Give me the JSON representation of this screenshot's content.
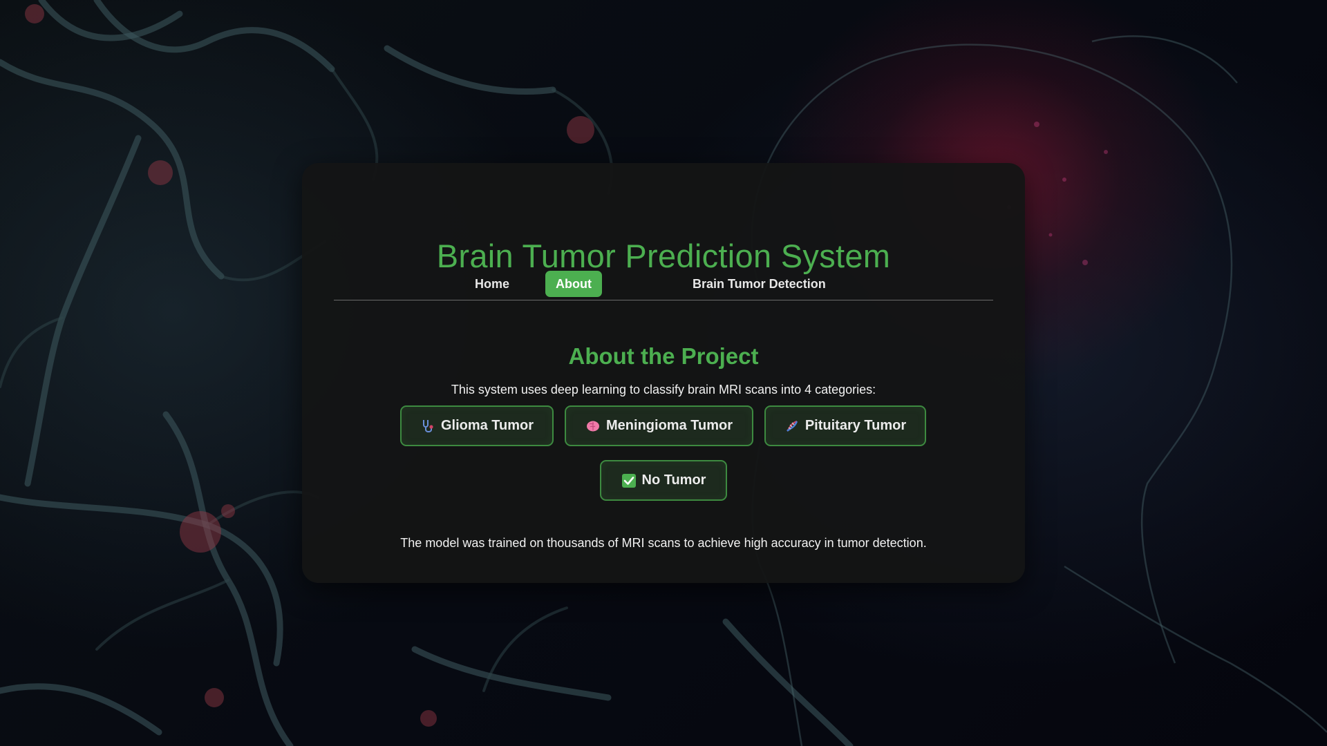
{
  "header": {
    "title": "Brain Tumor Prediction System"
  },
  "nav": {
    "items": [
      {
        "label": "Home",
        "active": false
      },
      {
        "label": "About",
        "active": true
      },
      {
        "label": "Brain Tumor Detection",
        "active": false
      }
    ]
  },
  "about": {
    "heading": "About the Project",
    "intro": "This system uses deep learning to classify brain MRI scans into 4 categories:",
    "categories": [
      {
        "label": "Glioma Tumor",
        "icon": "stethoscope-icon"
      },
      {
        "label": "Meningioma Tumor",
        "icon": "brain-icon"
      },
      {
        "label": "Pituitary Tumor",
        "icon": "dna-icon"
      },
      {
        "label": "No Tumor",
        "icon": "check-mark-icon"
      }
    ],
    "outro": "The model was trained on thousands of MRI scans to achieve high accuracy in tumor detection."
  },
  "colors": {
    "accent": "#4caf50",
    "card_background": "#141515",
    "category_border": "#3d8a40"
  }
}
